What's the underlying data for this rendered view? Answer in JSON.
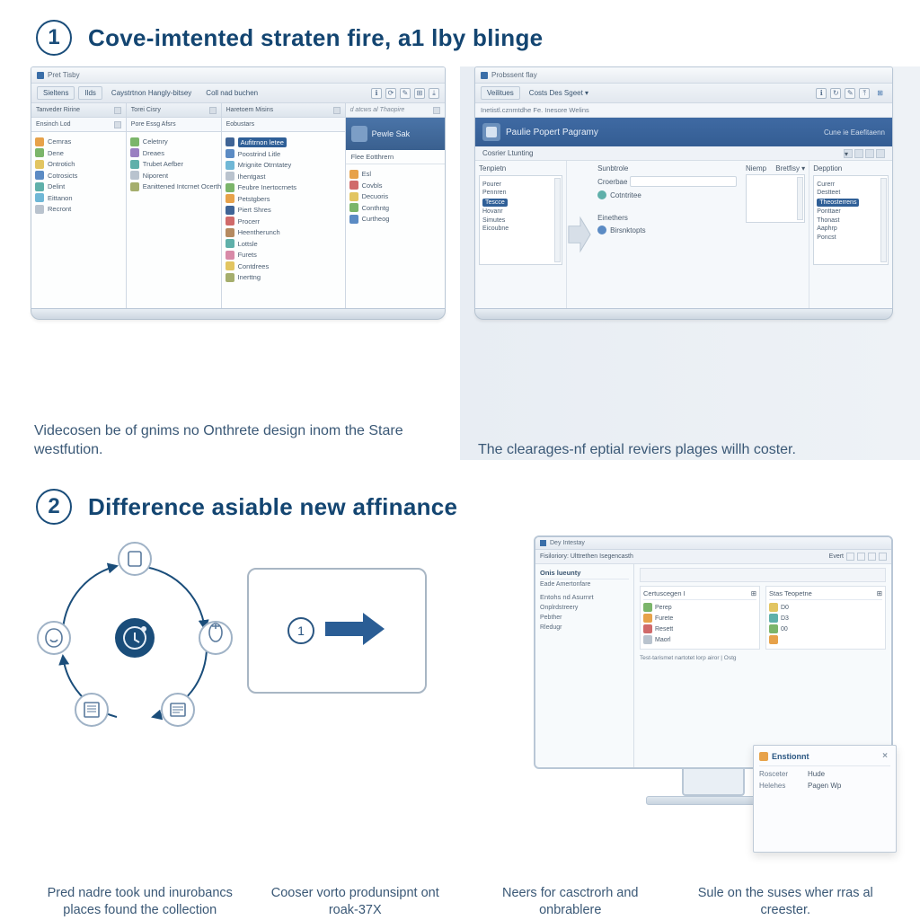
{
  "section1": {
    "number": "1",
    "title": "Cove-imtented straten fire, a1 lby blinge",
    "left": {
      "window_title": "Pret Tisby",
      "toolbar": {
        "btn1": "Sieltens",
        "btn2": "Ilds",
        "btn3": "Caystrtnon Hangly-bitsey",
        "btn4": "Coll nad buchen",
        "icons": [
          "ℹ",
          "⟳",
          "✎",
          "⊞",
          "⤓"
        ]
      },
      "panelA": {
        "title": "Tanveder Ririne",
        "sub": "Ensinch Lod",
        "items": [
          {
            "t": "Cemras",
            "c": "ic-orange"
          },
          {
            "t": "Dene",
            "c": "ic-green"
          },
          {
            "t": "Ontrotich",
            "c": "ic-yellow"
          },
          {
            "t": "Cotrosicts",
            "c": "ic-blue"
          },
          {
            "t": "Delint",
            "c": "ic-teal"
          },
          {
            "t": "Eittanon",
            "c": "ic-cyan"
          },
          {
            "t": "Recront",
            "c": "ic-grey"
          }
        ]
      },
      "panelB": {
        "title": "Torei Cisry",
        "sub": "Pore Essg Afsrs",
        "items": [
          {
            "t": "Celetnry",
            "c": "ic-green"
          },
          {
            "t": "Dreaes",
            "c": "ic-purple"
          },
          {
            "t": "Trubet Aefber",
            "c": "ic-teal"
          },
          {
            "t": "Niporent",
            "c": "ic-grey"
          },
          {
            "t": "Eanittened Intcrnet Ocerther otern",
            "c": "ic-olive"
          }
        ]
      },
      "panelC": {
        "title": "Haretoem Misins",
        "sub": "Eobustars",
        "selected": "Aufitrnon letee",
        "items": [
          {
            "t": "Poostrind Litle",
            "c": "ic-blue"
          },
          {
            "t": "Mrignite Otrntatey",
            "c": "ic-cyan"
          },
          {
            "t": "Ihentgast",
            "c": "ic-grey"
          },
          {
            "t": "Feubre Inertocrnets",
            "c": "ic-green"
          },
          {
            "t": "Petstgbers",
            "c": "ic-orange"
          },
          {
            "t": "Piert Shres",
            "c": "ic-navy"
          },
          {
            "t": "Procerr",
            "c": "ic-red"
          },
          {
            "t": "Heentherunch",
            "c": "ic-brown"
          },
          {
            "t": "Lottsle",
            "c": "ic-teal"
          },
          {
            "t": "Furets",
            "c": "ic-pink"
          },
          {
            "t": "Contdrees",
            "c": "ic-yellow"
          },
          {
            "t": "Inerttng",
            "c": "ic-olive"
          }
        ]
      },
      "panelD": {
        "title": "",
        "note": "d atcws al Thaopire",
        "items": [
          {
            "t": "Esl",
            "c": "ic-orange"
          },
          {
            "t": "Covbls",
            "c": "ic-red"
          },
          {
            "t": "Decuoris",
            "c": "ic-yellow"
          },
          {
            "t": "Conthntg",
            "c": "ic-green"
          },
          {
            "t": "Curtheog",
            "c": "ic-blue"
          }
        ]
      },
      "banner_label": "Pewle Sak",
      "banner_sub": "Flee Eotthrern",
      "caption": "Videcosen be of gnims no Onthrete design inom the Stare westfution."
    },
    "right": {
      "window_title": "Probssent flay",
      "toolbar": {
        "btn1": "Veilitues",
        "btn2": "Costs Des Sgeet ▾",
        "icons": [
          "ℹ",
          "↻",
          "✎",
          "⤒",
          "⊞"
        ]
      },
      "crumb": "Inetistl.cznmtdhe Fe. Inesore Welins",
      "banner_title": "Paulie Popert Pagramy",
      "banner_right": "Cune ie Eaefitaenn",
      "subbar": "Cosrier Ltunting",
      "colA": {
        "hd": "Tenpietn",
        "items": [
          "Pourer",
          "Pennren",
          "Tescce",
          "Hovanr",
          "Simutes",
          "Eicoubne"
        ]
      },
      "mid": {
        "hd": "Sunbtrole",
        "f1": "Croerbae",
        "f2": "Cotntritee",
        "f3": "Einethers",
        "chip": "Birsnktopts"
      },
      "colB": {
        "hd1": "Niemp",
        "hd2": "Depption",
        "items": [
          "Curerr",
          "Destteet",
          "Theosterrens",
          "Ponttaer",
          "Thonast",
          "Aaphrp",
          "Poncst"
        ],
        "sel": 2
      },
      "opts": {
        "label": "Bretfisy ▾",
        "extra": "⊞"
      },
      "caption": "The clearages-nf eptial reviers plages willh coster."
    }
  },
  "section2": {
    "number": "2",
    "title": "Difference asiable new affinance",
    "tablet_num": "1",
    "monitor": {
      "title": "Dey Intestay",
      "toolbar": "Fisiloriory: Ulttrethen Isegencasth",
      "tb_right": "Evert",
      "side": {
        "hd1": "Onis lueunty",
        "l1": "Eade Amertonfare",
        "l2": "Entohs nd Asurnrt",
        "l3": "Onplrdstreery",
        "l4": "Pebther",
        "l5": "Rledugr"
      },
      "left_col": {
        "hd": "Certuscegen I",
        "chip": "⊞",
        "items": [
          {
            "t": "Perep",
            "c": "ic-green"
          },
          {
            "t": "Furete",
            "c": "ic-orange"
          },
          {
            "t": "Resett",
            "c": "ic-red"
          },
          {
            "t": "Maorl",
            "c": "ic-grey"
          }
        ]
      },
      "right_col": {
        "hd": "Stas Teopetne",
        "chip": "⊞",
        "items": [
          {
            "t": "D0",
            "c": "ic-yellow"
          },
          {
            "t": "D3",
            "c": "ic-teal"
          },
          {
            "t": "00",
            "c": "ic-green"
          },
          {
            "t": "",
            "c": "ic-orange"
          }
        ]
      },
      "note": "Test-tarismet nartotet lorp airor | Ostg"
    },
    "popup": {
      "title": "Enstionnt",
      "f1l": "Rosceter",
      "f1v": "Hude",
      "f2l": "Helehes",
      "f2v": "Pagen Wp"
    },
    "captions": [
      "Pred nadre took und inurobancs places found the collection",
      "Cooser vorto produnsipnt ont roak-37X",
      "Neers for casctrorh and onbrablere",
      "Sule on the suses wher rras al creester."
    ]
  },
  "icon_colors": {
    "accent": "#1a4d7a"
  }
}
